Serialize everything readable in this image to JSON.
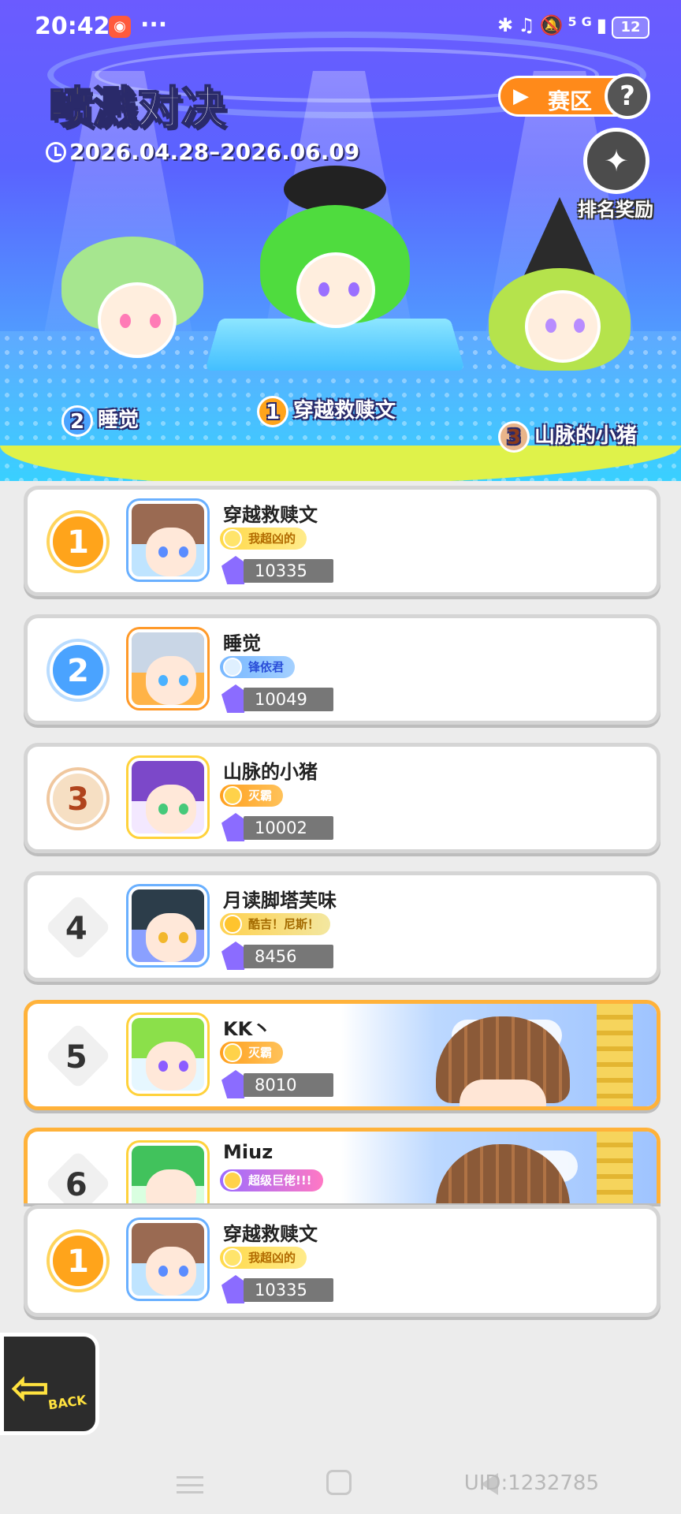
{
  "status_bar": {
    "time": "20:42",
    "more": "···",
    "network": "5G",
    "battery": "12"
  },
  "header": {
    "title_a": "喷溅",
    "title_b": "对决",
    "date_range": "2026.04.28–2026.06.09",
    "region_label": "赛区",
    "help_label": "?",
    "reward_label": "排名奖励"
  },
  "podium": [
    {
      "rank": "2",
      "name": "睡觉"
    },
    {
      "rank": "1",
      "name": "穿越救赎文"
    },
    {
      "rank": "3",
      "name": "山脉的小猪"
    }
  ],
  "rankings": [
    {
      "rank": "1",
      "name": "穿越救赎文",
      "badge": "我超凶的",
      "score": "10335"
    },
    {
      "rank": "2",
      "name": "睡觉",
      "badge": "锋依君",
      "score": "10049"
    },
    {
      "rank": "3",
      "name": "山脉的小猪",
      "badge": "灭霸",
      "score": "10002"
    },
    {
      "rank": "4",
      "name": "月读脚塔芙味",
      "badge": "酷吉！尼斯！",
      "score": "8456"
    },
    {
      "rank": "5",
      "name": "KK丶",
      "badge": "灭霸",
      "score": "8010"
    },
    {
      "rank": "6",
      "name": "Miuz",
      "badge": "超级巨佬!!!",
      "score": ""
    }
  ],
  "my_rank": {
    "rank": "1",
    "name": "穿越救赎文",
    "badge": "我超凶的",
    "score": "10335"
  },
  "back_label": "BACK",
  "uid": "UID:1232785"
}
